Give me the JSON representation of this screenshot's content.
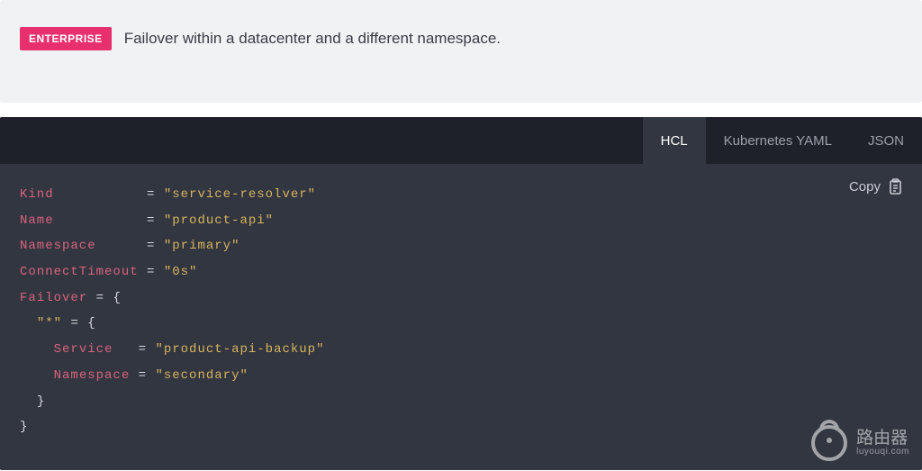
{
  "alert": {
    "badge": "ENTERPRISE",
    "text": "Failover within a datacenter and a different namespace."
  },
  "tabs": [
    {
      "label": "HCL",
      "active": true
    },
    {
      "label": "Kubernetes YAML",
      "active": false
    },
    {
      "label": "JSON",
      "active": false
    }
  ],
  "copy": {
    "label": "Copy"
  },
  "code": {
    "kind_key": "Kind",
    "kind_val": "\"service-resolver\"",
    "name_key": "Name",
    "name_val": "\"product-api\"",
    "ns_key": "Namespace",
    "ns_val": "\"primary\"",
    "ct_key": "ConnectTimeout",
    "ct_val": "\"0s\"",
    "fo_key": "Failover",
    "eq": "=",
    "brace_open": "{",
    "brace_close": "}",
    "star": "\"*\"",
    "svc_key": "Service",
    "svc_val": "\"product-api-backup\"",
    "ns2_key": "Namespace",
    "ns2_val": "\"secondary\""
  },
  "watermark": {
    "title": "路由器",
    "sub": "luyouqi.com"
  }
}
